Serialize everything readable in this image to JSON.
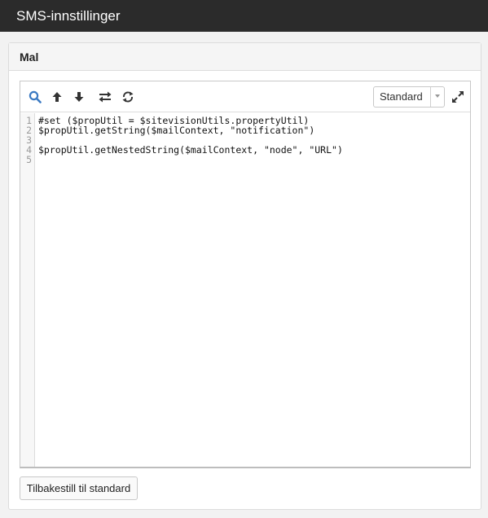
{
  "window": {
    "title": "SMS-innstillinger"
  },
  "panel": {
    "title": "Mal"
  },
  "toolbar": {
    "icons": [
      "search-icon",
      "arrow-up-icon",
      "arrow-down-icon",
      "replace-icon",
      "refresh-icon",
      "fullscreen-icon"
    ],
    "mode_select": {
      "selected": "Standard"
    }
  },
  "editor": {
    "line_numbers": [
      "1",
      "2",
      "3",
      "4",
      "5"
    ],
    "lines": [
      "#set ($propUtil = $sitevisionUtils.propertyUtil)",
      "$propUtil.getString($mailContext, \"notification\")",
      "",
      "$propUtil.getNestedString($mailContext, \"node\", \"URL\")",
      ""
    ]
  },
  "footer": {
    "reset_label": "Tilbakestill til standard"
  },
  "colors": {
    "titlebar_bg": "#2b2b2b",
    "search_icon": "#3a79c2",
    "icon_dark": "#333333"
  }
}
